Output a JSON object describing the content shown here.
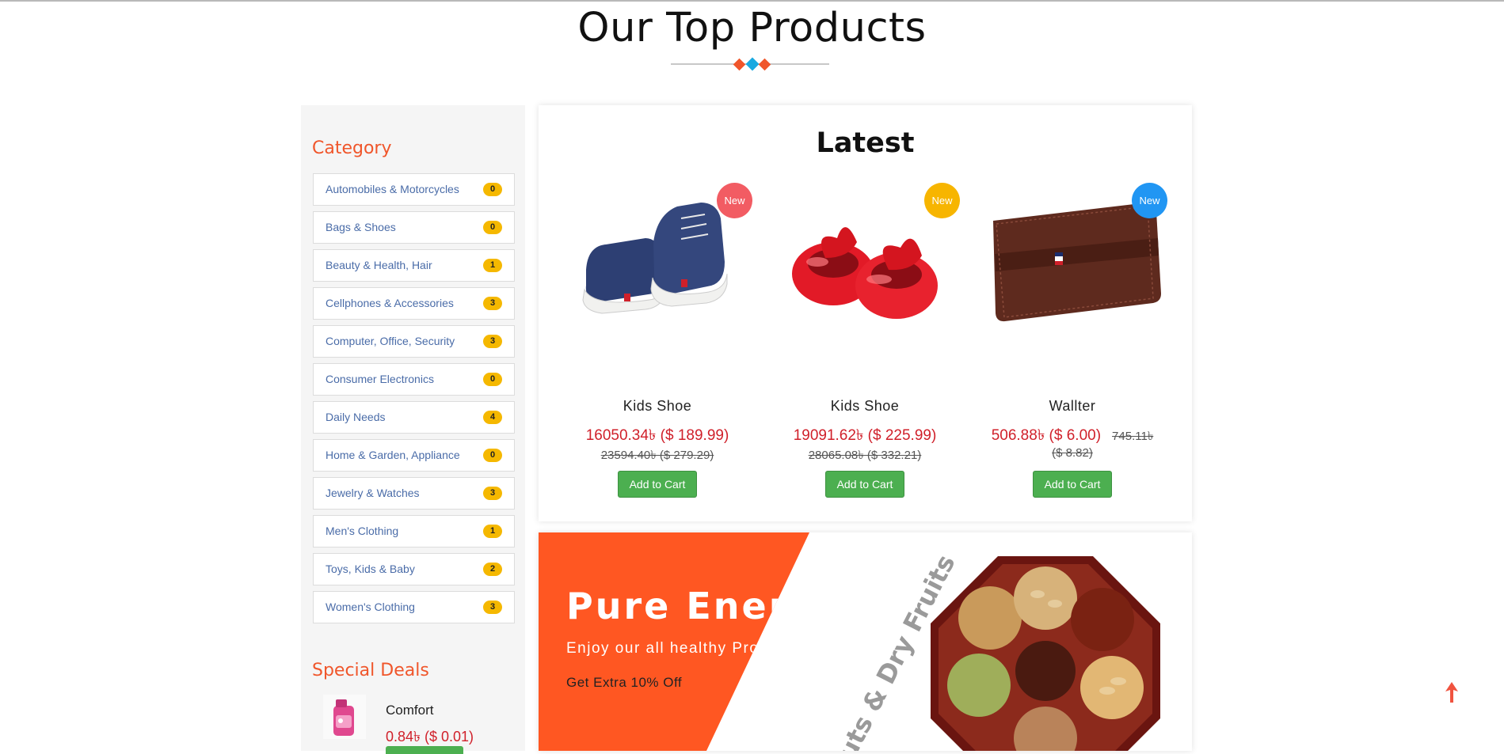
{
  "heading": {
    "title": "Our Top Products"
  },
  "sidebar": {
    "category_title": "Category",
    "categories": [
      {
        "label": "Automobiles & Motorcycles",
        "count": "0"
      },
      {
        "label": "Bags & Shoes",
        "count": "0"
      },
      {
        "label": "Beauty & Health, Hair",
        "count": "1"
      },
      {
        "label": "Cellphones & Accessories",
        "count": "3"
      },
      {
        "label": "Computer, Office, Security",
        "count": "3"
      },
      {
        "label": "Consumer Electronics",
        "count": "0"
      },
      {
        "label": "Daily Needs",
        "count": "4"
      },
      {
        "label": "Home & Garden, Appliance",
        "count": "0"
      },
      {
        "label": "Jewelry & Watches",
        "count": "3"
      },
      {
        "label": "Men's Clothing",
        "count": "1"
      },
      {
        "label": "Toys, Kids & Baby",
        "count": "2"
      },
      {
        "label": "Women's Clothing",
        "count": "3"
      }
    ],
    "deals_title": "Special Deals",
    "deal": {
      "name": "Comfort",
      "price": "0.84৳ ($ 0.01)"
    }
  },
  "latest": {
    "title": "Latest",
    "products": [
      {
        "badge": "New",
        "badge_color": "#f25c63",
        "name": "Kids Shoe",
        "price": "16050.34৳ ($ 189.99)",
        "old_price": "23594.40৳ ($ 279.29)",
        "button": "Add to Cart"
      },
      {
        "badge": "New",
        "badge_color": "#f7b500",
        "name": "Kids Shoe",
        "price": "19091.62৳ ($ 225.99)",
        "old_price": "28065.08৳ ($ 332.21)",
        "button": "Add to Cart"
      },
      {
        "badge": "New",
        "badge_color": "#2196f3",
        "name": "Wallter",
        "price": "506.88৳ ($ 6.00)",
        "old_price_a": "745.11৳",
        "old_price_b": "($ 8.82)",
        "button": "Add to Cart"
      }
    ]
  },
  "banner": {
    "heading": "Pure Energy",
    "subtitle": "Enjoy our all healthy Products",
    "offer": "Get Extra 10% Off",
    "side_text": "Nuts & Dry Fruits"
  },
  "colors": {
    "accent": "#f0562b",
    "price": "#d0202a",
    "button": "#4caf50",
    "badge": "#f5b800"
  }
}
